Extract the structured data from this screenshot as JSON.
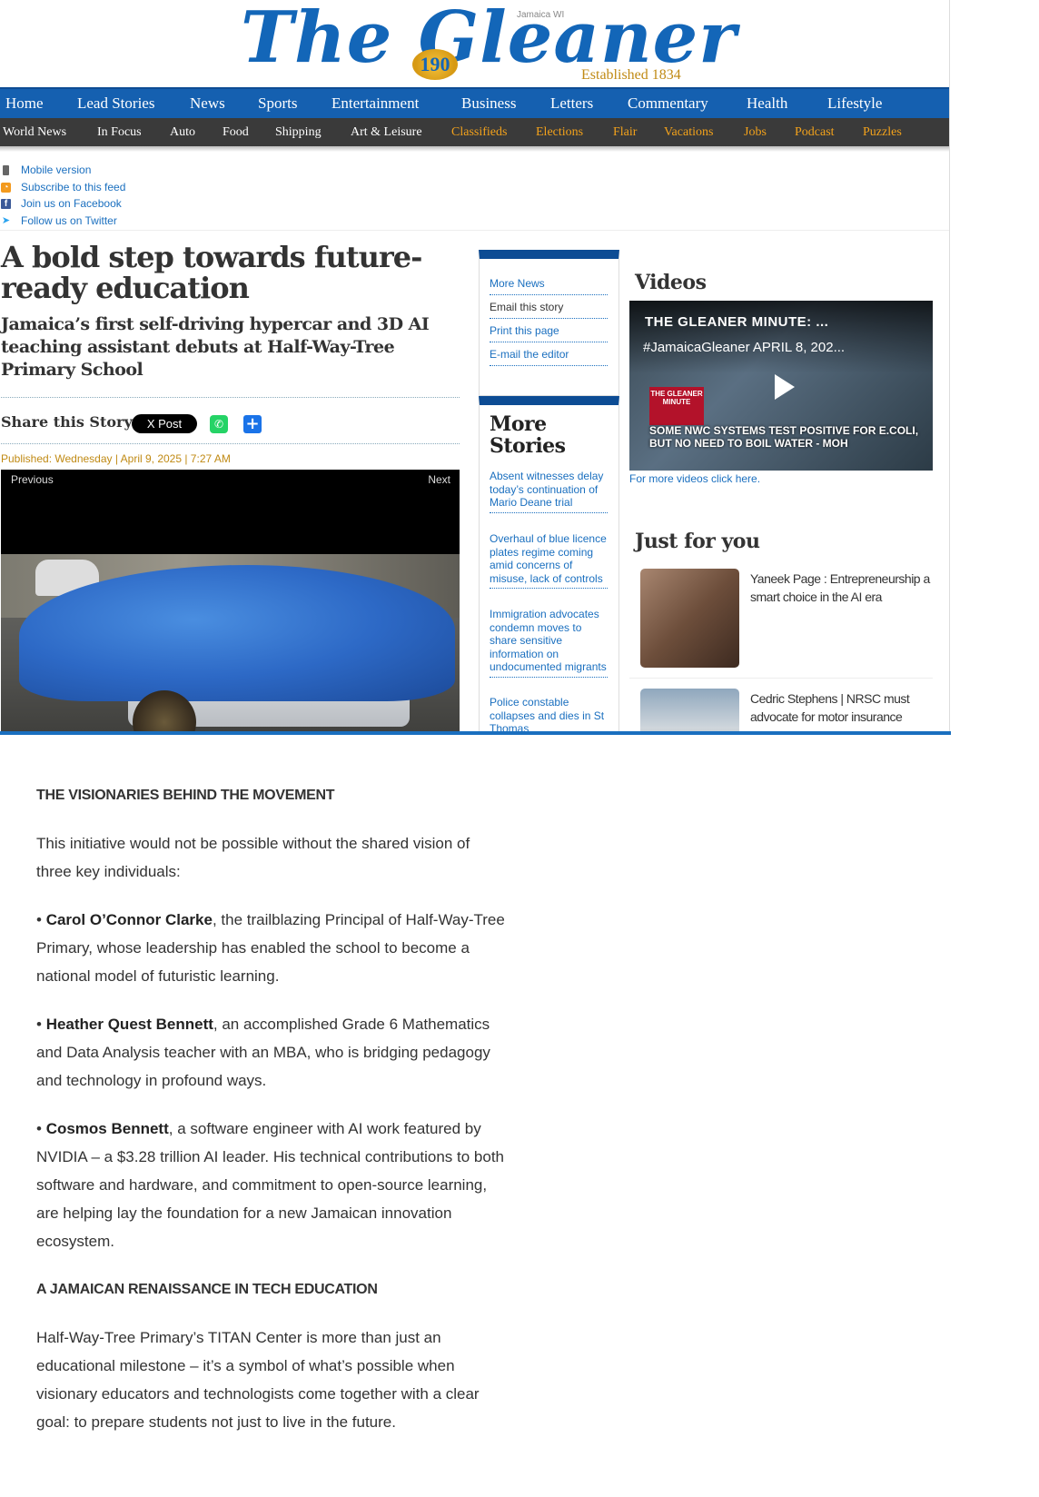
{
  "masthead": {
    "logo_text": "The Gleaner",
    "location": "Jamaica WI",
    "established": "Established 1834",
    "anniversary": "190"
  },
  "nav_primary": [
    "Home",
    "Lead Stories",
    "News",
    "Sports",
    "Entertainment",
    "Business",
    "Letters",
    "Commentary",
    "Health",
    "Lifestyle"
  ],
  "nav_secondary": [
    {
      "label": "World News",
      "accent": false
    },
    {
      "label": "In Focus",
      "accent": false
    },
    {
      "label": "Auto",
      "accent": false
    },
    {
      "label": "Food",
      "accent": false
    },
    {
      "label": "Shipping",
      "accent": false
    },
    {
      "label": "Art & Leisure",
      "accent": false
    },
    {
      "label": "Classifieds",
      "accent": true
    },
    {
      "label": "Elections",
      "accent": true
    },
    {
      "label": "Flair",
      "accent": true
    },
    {
      "label": "Vacations",
      "accent": true
    },
    {
      "label": "Jobs",
      "accent": true
    },
    {
      "label": "Podcast",
      "accent": true
    },
    {
      "label": "Puzzles",
      "accent": true
    }
  ],
  "utility_links": [
    {
      "label": "Mobile version",
      "icon": "mobile-icon"
    },
    {
      "label": "Subscribe to this feed",
      "icon": "rss-icon"
    },
    {
      "label": "Join us on Facebook",
      "icon": "facebook-icon"
    },
    {
      "label": "Follow us on Twitter",
      "icon": "twitter-icon"
    }
  ],
  "article": {
    "headline": "A bold step towards future-ready education",
    "subhead": "Jamaica’s first self-driving hypercar and 3D AI teaching assistant debuts at Half-Way-Tree Primary School",
    "share_label": "Share this Story:",
    "x_post_label": "X Post",
    "published": "Published:  Wednesday | April 9, 2025 | 7:27 AM",
    "slideshow_prev": "Previous",
    "slideshow_next": "Next"
  },
  "sidebar_links": [
    "More News",
    "Email this story",
    "Print this page",
    "E-mail the editor"
  ],
  "more_stories": {
    "title": "More Stories",
    "items": [
      "Absent witnesses delay today’s continuation of Mario Deane trial",
      "Overhaul of blue licence plates regime coming amid concerns of misuse, lack of controls",
      "Immigration advocates condemn moves to share sensitive information on undocumented migrants",
      "Police constable collapses and dies in St Thomas"
    ]
  },
  "videos": {
    "title": "Videos",
    "video_title": "THE GLEANER MINUTE: ...",
    "video_subtitle": "#JamaicaGleaner APRIL 8, 202...",
    "brand_label": "THE GLEANER MINUTE",
    "caption": "SOME NWC SYSTEMS TEST POSITIVE FOR E.COLI, BUT NO NEED TO BOIL WATER - MOH",
    "more_link": "For more videos click here."
  },
  "just_for_you": {
    "title": "Just for you",
    "items": [
      "Yaneek Page : Entrepreneurship a smart choice in the AI era",
      "Cedric Stephens | NRSC must advocate for motor insurance"
    ]
  },
  "body": {
    "heading1": "THE VISIONARIES BEHIND THE MOVEMENT",
    "intro": "This initiative would not be possible without the shared vision of three key individuals:",
    "people": [
      {
        "bullet": "• ",
        "name": "Carol O’Connor Clarke",
        "desc": ", the trailblazing Principal of Half-Way-Tree Primary, whose leadership has enabled the school to become a national model of futuristic learning."
      },
      {
        "bullet": "• ",
        "name": "Heather Quest Bennett",
        "desc": ", an accomplished Grade 6 Mathematics and Data Analysis teacher with an MBA, who is bridging pedagogy and technology in profound ways."
      },
      {
        "bullet": "• ",
        "name": "Cosmos Bennett",
        "desc": ", a software engineer with AI work featured by NVIDIA – a $3.28 trillion AI leader. His technical contributions to both software and hardware, and commitment to open-source learning, are helping lay the foundation for a new Jamaican innovation ecosystem."
      }
    ],
    "heading2": "A JAMAICAN RENAISSANCE IN TECH EDUCATION",
    "closing": "Half-Way-Tree Primary’s TITAN Center is more than just an educational milestone – it’s a symbol of what’s possible when visionary educators and technologists come together with a clear goal: to prepare students not just to live in the future."
  },
  "colors": {
    "brand_blue": "#1366b8",
    "nav_blue": "#1560b0",
    "nav_dark": "#3a3a3a",
    "accent_orange": "#f3a21b",
    "link_blue": "#1a6fbf",
    "gold": "#c08a14"
  }
}
